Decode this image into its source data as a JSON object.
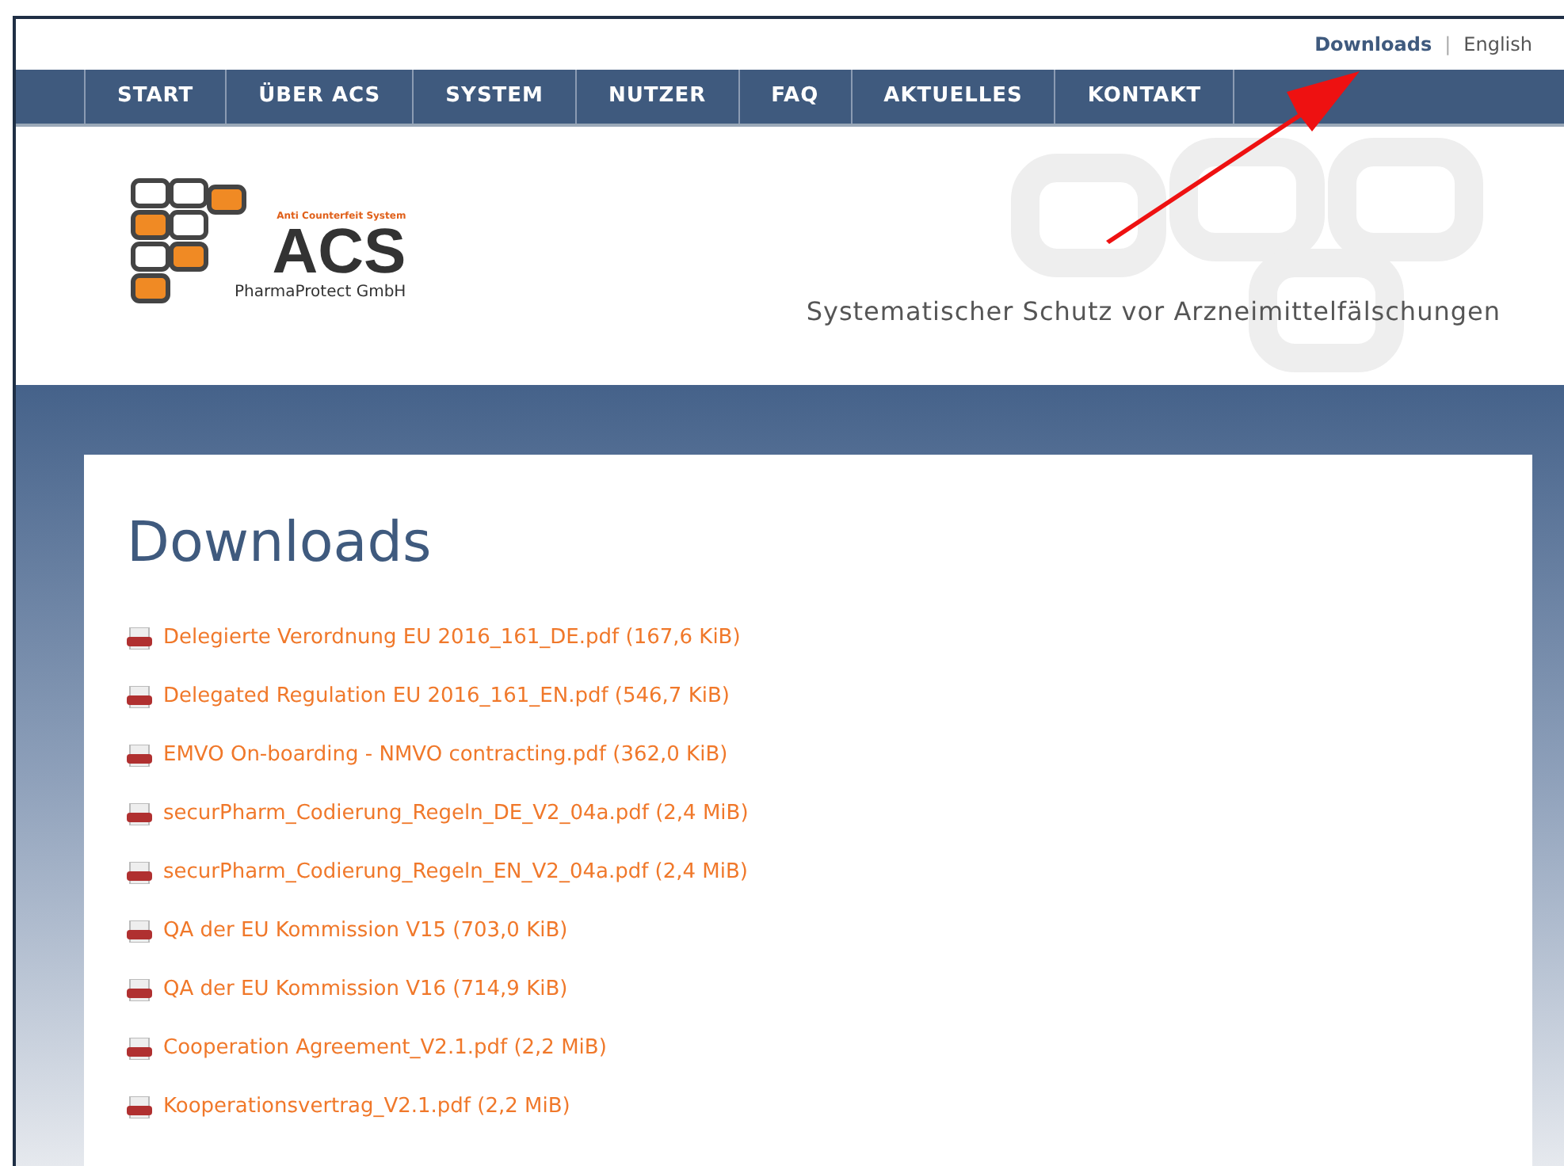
{
  "top_links": [
    {
      "label": "Downloads",
      "selected": true
    },
    {
      "label": "English",
      "selected": false
    }
  ],
  "top_separator": "|",
  "nav": [
    "START",
    "ÜBER ACS",
    "SYSTEM",
    "NUTZER",
    "FAQ",
    "AKTUELLES",
    "KONTAKT"
  ],
  "logo": {
    "tagline": "Anti Counterfeit System",
    "name": "ACS",
    "company": "PharmaProtect GmbH"
  },
  "slogan": "Systematischer Schutz vor Arzneimittelfälschungen",
  "heading": "Downloads",
  "downloads": [
    "Delegierte Verordnung EU 2016_161_DE.pdf (167,6 KiB)",
    "Delegated Regulation EU 2016_161_EN.pdf (546,7 KiB)",
    "EMVO On-boarding - NMVO contracting.pdf (362,0 KiB)",
    "securPharm_Codierung_Regeln_DE_V2_04a.pdf (2,4 MiB)",
    "securPharm_Codierung_Regeln_EN_V2_04a.pdf (2,4 MiB)",
    "QA der EU Kommission V15 (703,0 KiB)",
    "QA der EU Kommission V16 (714,9 KiB)",
    "Cooperation Agreement_V2.1.pdf (2,2 MiB)",
    "Kooperationsvertrag_V2.1.pdf (2,2 MiB)"
  ]
}
